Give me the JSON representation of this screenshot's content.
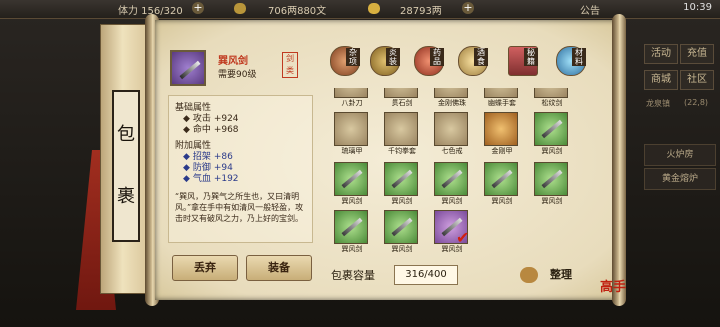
{
  "topbar": {
    "stamina": "体力 156/320",
    "silver": "706两880文",
    "gold": "28793两",
    "notice": "公告",
    "time": "10:39"
  },
  "side": {
    "btn1": "活动",
    "btn2": "充值",
    "btn3": "商城",
    "btn4": "社区",
    "location": "龙泉镇",
    "coords": "(22,8)",
    "furnace1": "火炉房",
    "furnace2": "黄金熔炉"
  },
  "scroll": {
    "title_top": "包",
    "title_bottom": "裹"
  },
  "item": {
    "name": "巽风剑",
    "requirement": "需要90级",
    "seal": "剑类"
  },
  "stats": {
    "base_title": "基础属性",
    "base": [
      {
        "label": "攻击",
        "value": "+924"
      },
      {
        "label": "命中",
        "value": "+968"
      }
    ],
    "extra_title": "附加属性",
    "extra": [
      {
        "label": "招架",
        "value": "+86"
      },
      {
        "label": "防御",
        "value": "+94"
      },
      {
        "label": "气血",
        "value": "+192"
      }
    ],
    "description": "“巽风，乃巽气之所生也，又曰清明风。”拿在手中有如清风一般轻盈，攻击时又有破风之力，乃上好的宝剑。"
  },
  "buttons": {
    "discard": "丢弃",
    "equip": "装备",
    "sort": "整理"
  },
  "categories": [
    {
      "label": "杂项",
      "icon": "misc-icon",
      "color": "#c07040"
    },
    {
      "label": "炎装",
      "icon": "armor-icon",
      "color": "#c09040"
    },
    {
      "label": "药品",
      "icon": "medicine-icon",
      "color": "#d06040"
    },
    {
      "label": "酒食",
      "icon": "food-icon",
      "color": "#e0c070"
    },
    {
      "label": "秘籍",
      "icon": "book-icon",
      "color": "#a04040"
    },
    {
      "label": "材料",
      "icon": "material-icon",
      "color": "#60a0d0"
    }
  ],
  "grid": {
    "row1": [
      "八卦刀",
      "贯石剑",
      "金刚佛珠",
      "幽蝶手套",
      "松纹剑"
    ],
    "row2": [
      "琉璃甲",
      "千钧拳套",
      "七色戒",
      "金刚甲",
      "巽风剑"
    ],
    "row3": [
      "巽风剑",
      "巽风剑",
      "巽风剑",
      "巽风剑",
      "巽风剑"
    ],
    "row4": [
      "巽风剑",
      "巽风剑",
      "巽风剑"
    ]
  },
  "capacity": {
    "label": "包裹容量",
    "value": "316/400"
  },
  "stamp": "高手"
}
